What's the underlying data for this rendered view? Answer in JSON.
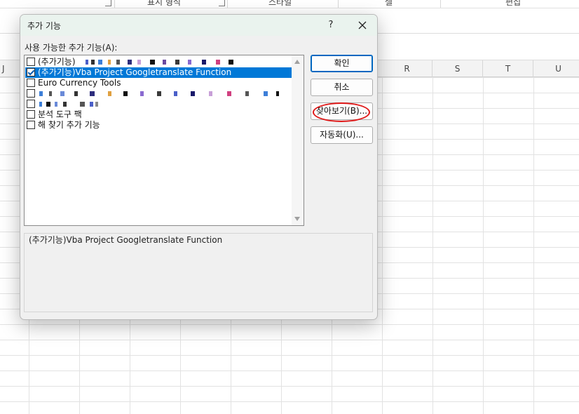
{
  "excel": {
    "ribbon_groups": [
      "표시 형식",
      "스타일",
      "셀",
      "편집"
    ],
    "columns": [
      "J",
      "R",
      "S",
      "T",
      "U"
    ]
  },
  "dialog": {
    "title": "추가 기능",
    "help_label": "?",
    "list_label": "사용 가능한 추가 기능(A):",
    "items": [
      {
        "label": "(추가기능)",
        "checked": false,
        "selected": false
      },
      {
        "label": "(추가기능)Vba Project Googletranslate Function",
        "checked": true,
        "selected": true
      },
      {
        "label": "Euro Currency Tools",
        "checked": false,
        "selected": false
      },
      {
        "label": "",
        "checked": false,
        "selected": false
      },
      {
        "label": "",
        "checked": false,
        "selected": false
      },
      {
        "label": "분석 도구 팩",
        "checked": false,
        "selected": false
      },
      {
        "label": "해 찾기 추가 기능",
        "checked": false,
        "selected": false
      }
    ],
    "buttons": {
      "ok": "확인",
      "cancel": "취소",
      "browse": "찾아보기(B)...",
      "automation": "자동화(U)..."
    },
    "description": "(추가기능)Vba Project Googletranslate Function",
    "colors": {
      "selection": "#0078d7",
      "title_bar": "#eaf3ee",
      "annotation_circle": "#e01818"
    }
  }
}
